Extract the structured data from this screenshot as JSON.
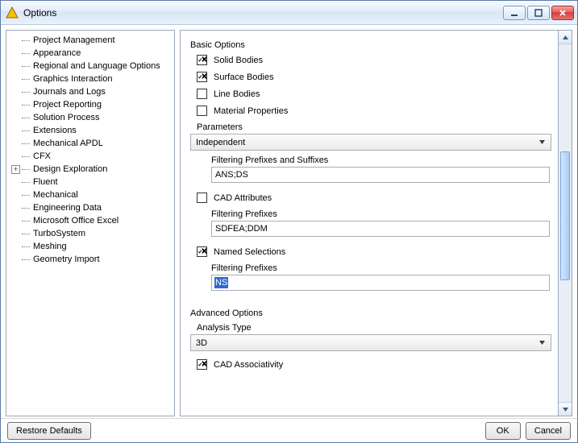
{
  "window": {
    "title": "Options"
  },
  "titlebar_icons": {
    "min": "minimize",
    "max": "maximize",
    "close": "close"
  },
  "tree": {
    "items": [
      {
        "label": "Project Management",
        "expandable": false
      },
      {
        "label": "Appearance",
        "expandable": false
      },
      {
        "label": "Regional and Language Options",
        "expandable": false
      },
      {
        "label": "Graphics Interaction",
        "expandable": false
      },
      {
        "label": "Journals and Logs",
        "expandable": false
      },
      {
        "label": "Project Reporting",
        "expandable": false
      },
      {
        "label": "Solution Process",
        "expandable": false
      },
      {
        "label": "Extensions",
        "expandable": false
      },
      {
        "label": "Mechanical APDL",
        "expandable": false
      },
      {
        "label": "CFX",
        "expandable": false
      },
      {
        "label": "Design Exploration",
        "expandable": true
      },
      {
        "label": "Fluent",
        "expandable": false
      },
      {
        "label": "Mechanical",
        "expandable": false
      },
      {
        "label": "Engineering Data",
        "expandable": false
      },
      {
        "label": "Microsoft Office Excel",
        "expandable": false
      },
      {
        "label": "TurboSystem",
        "expandable": false
      },
      {
        "label": "Meshing",
        "expandable": false
      },
      {
        "label": "Geometry Import",
        "expandable": false
      }
    ]
  },
  "basic": {
    "section_title": "Basic Options",
    "solid_bodies": {
      "label": "Solid Bodies",
      "checked": true
    },
    "surface_bodies": {
      "label": "Surface Bodies",
      "checked": true
    },
    "line_bodies": {
      "label": "Line Bodies",
      "checked": false
    },
    "material_props": {
      "label": "Material Properties",
      "checked": false
    },
    "parameters": {
      "label": "Parameters",
      "value": "Independent",
      "filter_label": "Filtering Prefixes and Suffixes",
      "filter_value": "ANS;DS"
    },
    "cad_attributes": {
      "label": "CAD Attributes",
      "checked": false,
      "filter_label": "Filtering Prefixes",
      "filter_value": "SDFEA;DDM"
    },
    "named_selections": {
      "label": "Named Selections",
      "checked": true,
      "filter_label": "Filtering Prefixes",
      "filter_value": "NS"
    }
  },
  "advanced": {
    "section_title": "Advanced Options",
    "analysis_type": {
      "label": "Analysis Type",
      "value": "3D"
    },
    "cad_assoc": {
      "label": "CAD Associativity",
      "checked": true
    }
  },
  "footer": {
    "restore": "Restore Defaults",
    "ok": "OK",
    "cancel": "Cancel"
  }
}
